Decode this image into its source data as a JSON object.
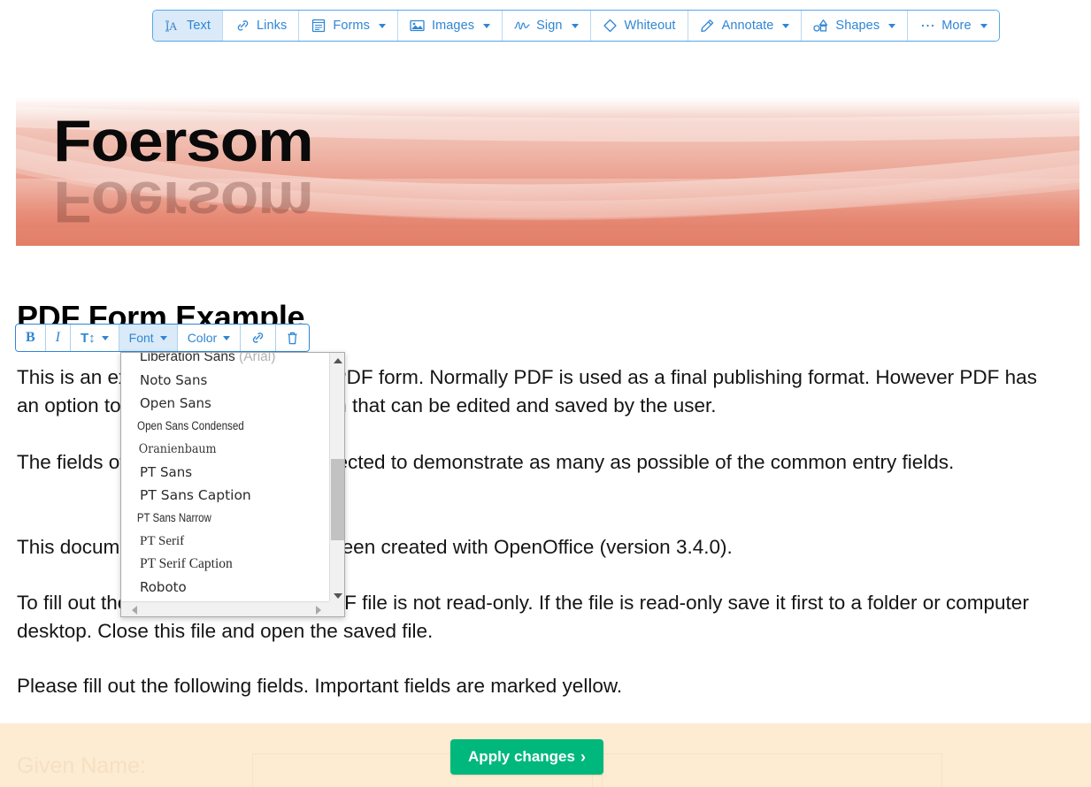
{
  "toolbar": {
    "items": [
      {
        "label": "Text",
        "icon": "text-format-icon",
        "caret": false,
        "active": true
      },
      {
        "label": "Links",
        "icon": "link-icon",
        "caret": false,
        "active": false
      },
      {
        "label": "Forms",
        "icon": "form-icon",
        "caret": true,
        "active": false
      },
      {
        "label": "Images",
        "icon": "image-icon",
        "caret": true,
        "active": false
      },
      {
        "label": "Sign",
        "icon": "signature-icon",
        "caret": true,
        "active": false
      },
      {
        "label": "Whiteout",
        "icon": "eraser-icon",
        "caret": false,
        "active": false
      },
      {
        "label": "Annotate",
        "icon": "highlighter-icon",
        "caret": true,
        "active": false
      },
      {
        "label": "Shapes",
        "icon": "shapes-icon",
        "caret": true,
        "active": false
      },
      {
        "label": "More",
        "icon": "ellipsis-icon",
        "caret": true,
        "active": false
      }
    ]
  },
  "format_toolbar": {
    "bold_label": "B",
    "italic_label": "I",
    "size_label": "T↕",
    "font_label": "Font",
    "color_label": "Color",
    "link_icon": "link-icon",
    "delete_icon": "trash-icon"
  },
  "font_dropdown": {
    "options": [
      {
        "name": "Liberation Sans",
        "alias": "(Arial)"
      },
      {
        "name": "Noto Sans",
        "alias": ""
      },
      {
        "name": "Open Sans",
        "alias": ""
      },
      {
        "name": "Open Sans Condensed",
        "alias": ""
      },
      {
        "name": "Oranienbaum",
        "alias": ""
      },
      {
        "name": "PT Sans",
        "alias": ""
      },
      {
        "name": "PT Sans Caption",
        "alias": ""
      },
      {
        "name": "PT Sans Narrow",
        "alias": ""
      },
      {
        "name": "PT Serif",
        "alias": ""
      },
      {
        "name": "PT Serif Caption",
        "alias": ""
      },
      {
        "name": "Roboto",
        "alias": ""
      }
    ]
  },
  "document": {
    "banner_logo_text": "Foersom",
    "title": "PDF Form Example",
    "paragraphs": [
      "This is an example of a user fillable PDF form. Normally PDF is used as a final publishing format. However PDF has an option to be used as an entry form that can be edited and saved by the user.",
      "The fields of this form have been selected to demonstrate as many as possible of the common entry fields.",
      "This document and PDF form have been created with OpenOffice (version 3.4.0).",
      "To fill out the form, make sure the PDF file is not read-only. If the file is read-only save it first to a folder or computer desktop. Close this file and open the saved file.",
      "Please fill out the following fields. Important fields are marked yellow."
    ],
    "form_first_label": "Given Name:"
  },
  "footer": {
    "apply_label": "Apply changes",
    "apply_chevron": "›"
  },
  "colors": {
    "accent_blue": "#2f86d4",
    "toolbar_border": "#5aa9e8",
    "active_bg": "#daeaf8",
    "apply_green": "#00b87c",
    "form_bg": "#fdebd2",
    "banner_salmon": "#e58572"
  }
}
